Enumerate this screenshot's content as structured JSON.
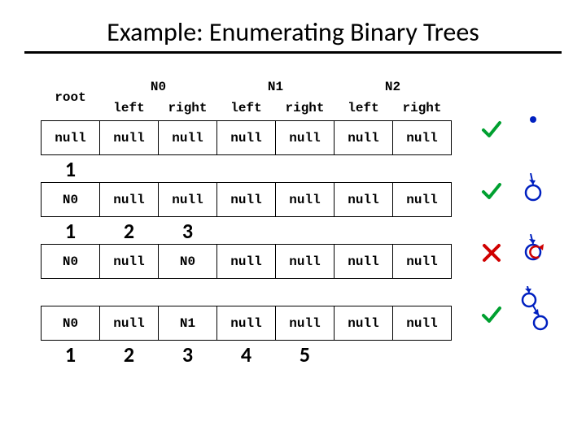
{
  "title": "Example: Enumerating Binary Trees",
  "columns": {
    "root": "root",
    "groups": [
      {
        "name": "N0",
        "left": "left",
        "right": "right"
      },
      {
        "name": "N1",
        "left": "left",
        "right": "right"
      },
      {
        "name": "N2",
        "left": "left",
        "right": "right"
      }
    ]
  },
  "rows": [
    {
      "cells": [
        "null",
        "null",
        "null",
        "null",
        "null",
        "null",
        "null"
      ],
      "mark": "check",
      "tree": "dot"
    },
    {
      "nums": [
        "1"
      ]
    },
    {
      "cells": [
        "N0",
        "null",
        "null",
        "null",
        "null",
        "null",
        "null"
      ],
      "mark": "check",
      "tree": "single"
    },
    {
      "nums": [
        "1",
        "2",
        "3"
      ]
    },
    {
      "cells": [
        "N0",
        "null",
        "N0",
        "null",
        "null",
        "null",
        "null"
      ],
      "mark": "cross",
      "tree": "selfloop"
    },
    {
      "nums": []
    },
    {
      "cells": [
        "N0",
        "null",
        "N1",
        "null",
        "null",
        "null",
        "null"
      ],
      "mark": "check",
      "tree": "chain"
    },
    {
      "nums": [
        "1",
        "2",
        "3",
        "4",
        "5"
      ]
    }
  ],
  "chart_data": {
    "type": "table",
    "title": "Example: Enumerating Binary Trees",
    "columns": [
      "root",
      "N0.left",
      "N0.right",
      "N1.left",
      "N1.right",
      "N2.left",
      "N2.right"
    ],
    "data_rows": [
      {
        "values": [
          "null",
          "null",
          "null",
          "null",
          "null",
          "null",
          "null"
        ],
        "status": "valid",
        "step_labels": [
          1
        ]
      },
      {
        "values": [
          "N0",
          "null",
          "null",
          "null",
          "null",
          "null",
          "null"
        ],
        "status": "valid",
        "step_labels": [
          1,
          2,
          3
        ]
      },
      {
        "values": [
          "N0",
          "null",
          "N0",
          "null",
          "null",
          "null",
          "null"
        ],
        "status": "invalid",
        "step_labels": []
      },
      {
        "values": [
          "N0",
          "null",
          "N1",
          "null",
          "null",
          "null",
          "null"
        ],
        "status": "valid",
        "step_labels": [
          1,
          2,
          3,
          4,
          5
        ]
      }
    ]
  }
}
